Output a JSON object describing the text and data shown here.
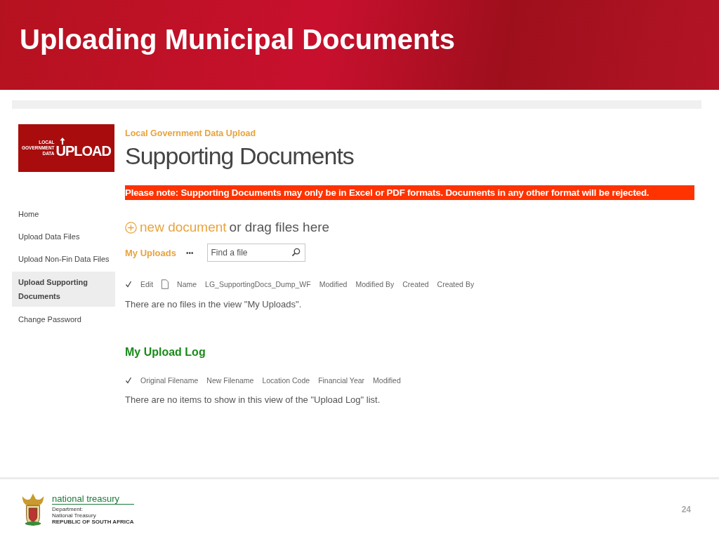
{
  "slide": {
    "title": "Uploading Municipal Documents",
    "page_number": "24"
  },
  "logo": {
    "small_lines": [
      "LOCAL",
      "GOVERNMENT",
      "DATA"
    ],
    "word": "UPLOAD"
  },
  "site_title": "Local Government Data Upload",
  "page_title": "Supporting Documents",
  "nav": [
    {
      "label": "Home",
      "selected": false
    },
    {
      "label": "Upload Data Files",
      "selected": false
    },
    {
      "label": "Upload Non-Fin Data Files",
      "selected": false
    },
    {
      "label": "Upload Supporting Documents",
      "selected": true
    },
    {
      "label": "Change Password",
      "selected": false
    }
  ],
  "notice": "Please note: Supporting Documents may only be in Excel or PDF formats.  Documents in any other format will be rejected.",
  "new_document": {
    "link": "new document",
    "text": "or drag files here"
  },
  "uploads": {
    "view": "My Uploads",
    "more": "•••",
    "search": {
      "placeholder": "Find a file"
    },
    "columns": [
      {
        "kind": "check"
      },
      {
        "kind": "text",
        "label": "Edit"
      },
      {
        "kind": "file"
      },
      {
        "kind": "text",
        "label": "Name"
      },
      {
        "kind": "text",
        "label": "LG_SupportingDocs_Dump_WF"
      },
      {
        "kind": "text",
        "label": "Modified"
      },
      {
        "kind": "text",
        "label": "Modified By"
      },
      {
        "kind": "text",
        "label": "Created"
      },
      {
        "kind": "text",
        "label": "Created By"
      }
    ],
    "empty": "There are no files in the view \"My Uploads\"."
  },
  "log": {
    "title": "My Upload Log",
    "columns": [
      {
        "kind": "check"
      },
      {
        "kind": "text",
        "label": "Original Filename"
      },
      {
        "kind": "text",
        "label": "New Filename"
      },
      {
        "kind": "text",
        "label": "Location Code"
      },
      {
        "kind": "text",
        "label": "Financial Year"
      },
      {
        "kind": "text",
        "label": "Modified"
      }
    ],
    "empty": "There are no items to show in this view of the \"Upload Log\" list."
  },
  "footer": {
    "org": "national treasury",
    "lines": [
      "Department:",
      "National Treasury",
      "REPUBLIC OF SOUTH AFRICA"
    ]
  }
}
